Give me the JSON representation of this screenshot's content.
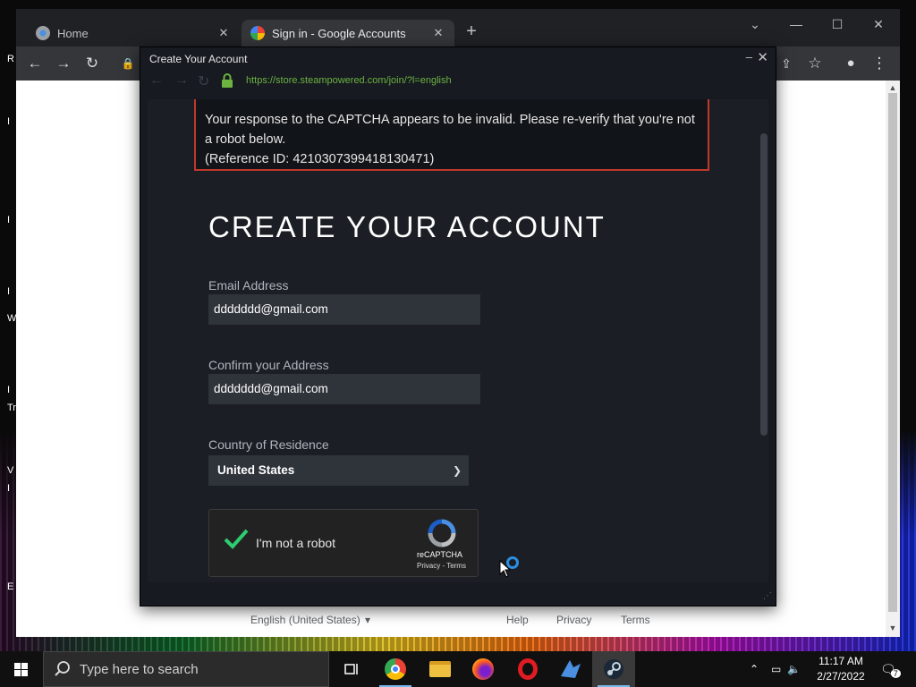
{
  "desktop": {
    "letters": [
      "R",
      "I",
      "I",
      "I",
      "W",
      "I",
      "Tr",
      "V",
      "I",
      "E"
    ]
  },
  "browser": {
    "tabs": [
      {
        "title": "Home",
        "active": false
      },
      {
        "title": "Sign in - Google Accounts",
        "active": true
      }
    ],
    "new_tab": "+",
    "footer": {
      "language": "English (United States)",
      "help": "Help",
      "privacy": "Privacy",
      "terms": "Terms"
    }
  },
  "steam_window": {
    "title": "Create Your Account",
    "url": "https://store.steampowered.com/join/?l=english",
    "error": {
      "line1": "Your response to the CAPTCHA appears to be invalid. Please re-verify that you're not a robot below.",
      "line2": "(Reference ID: 4210307399418130471)"
    },
    "heading": "CREATE YOUR ACCOUNT",
    "email_label": "Email Address",
    "email_value": "ddddddd@gmail.com",
    "confirm_label": "Confirm your Address",
    "confirm_value": "ddddddd@gmail.com",
    "country_label": "Country of Residence",
    "country_value": "United States",
    "captcha": {
      "label": "I'm not a robot",
      "brand": "reCAPTCHA",
      "links": "Privacy - Terms"
    }
  },
  "taskbar": {
    "search_placeholder": "Type here to search",
    "time": "11:17 AM",
    "date": "2/27/2022",
    "notification_count": "7"
  },
  "colors": {
    "accent": "#2a8fe0",
    "error_border": "#c0392b",
    "check_green": "#2ecc71",
    "url_green": "#6cb340"
  }
}
